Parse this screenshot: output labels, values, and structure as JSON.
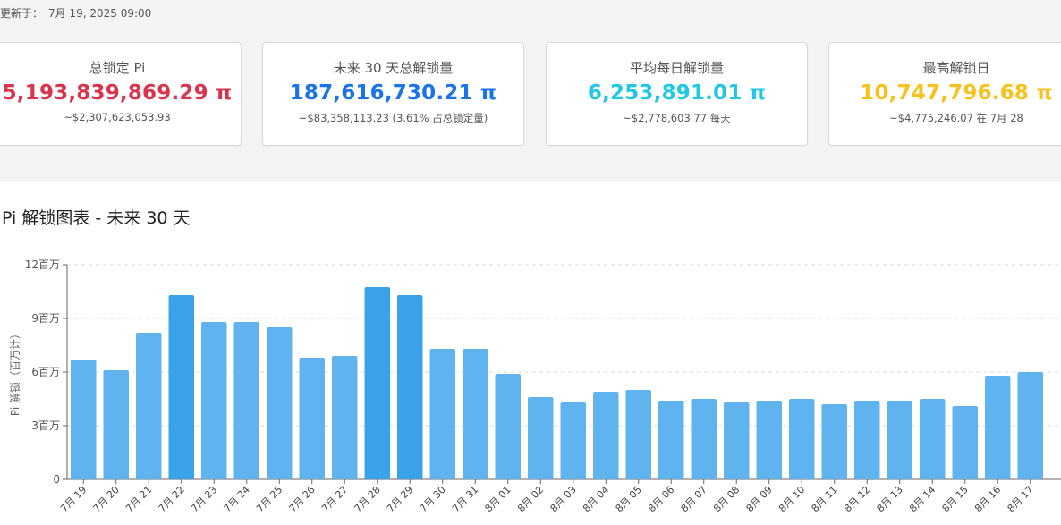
{
  "header": {
    "updated_label": "更新于：",
    "updated_value": "7月 19, 2025 09:00"
  },
  "cards": [
    {
      "title": "总锁定 Pi",
      "value": "5,193,839,869.29 π",
      "sub": "~$2,307,623,053.93",
      "color": "#d9344b"
    },
    {
      "title": "未来 30 天总解锁量",
      "value": "187,616,730.21 π",
      "sub": "~$83,358,113.23 (3.61% 占总锁定量)",
      "color": "#1a73e8"
    },
    {
      "title": "平均每日解锁量",
      "value": "6,253,891.01 π",
      "sub": "~$2,778,603.77 每天",
      "color": "#1ec8e6"
    },
    {
      "title": "最高解锁日",
      "value": "10,747,796.68 π",
      "sub": "~$4,775,246.07 在 7月 28",
      "color": "#f7c21d"
    }
  ],
  "chart_title": "Pi 解锁图表 - 未来 30 天",
  "colors": {
    "bar": "#5fb3ee",
    "bar_high": "#3aa2e9",
    "grid": "#d8d8d8",
    "axis": "#666666"
  },
  "chart_data": {
    "type": "bar",
    "categories": [
      "7月 19",
      "7月 20",
      "7月 21",
      "7月 22",
      "7月 23",
      "7月 24",
      "7月 25",
      "7月 26",
      "7月 27",
      "7月 28",
      "7月 29",
      "7月 30",
      "7月 31",
      "8月 01",
      "8月 02",
      "8月 03",
      "8月 04",
      "8月 05",
      "8月 06",
      "8月 07",
      "8月 08",
      "8月 09",
      "8月 10",
      "8月 11",
      "8月 12",
      "8月 13",
      "8月 14",
      "8月 15",
      "8月 16",
      "8月 17"
    ],
    "values": [
      6.7,
      6.1,
      8.2,
      10.3,
      8.8,
      8.8,
      8.5,
      6.8,
      6.9,
      10.75,
      10.3,
      7.3,
      7.3,
      5.9,
      4.6,
      4.3,
      4.9,
      5.0,
      4.4,
      4.5,
      4.3,
      4.4,
      4.5,
      4.2,
      4.4,
      4.4,
      4.5,
      4.1,
      5.8,
      6.0
    ],
    "ylabel": "Pi 解锁（百万计）",
    "ylim": [
      0,
      12
    ],
    "yticks": [
      0,
      3,
      6,
      9,
      12
    ],
    "ytick_labels": [
      "0",
      "3百万",
      "6百万",
      "9百万",
      "12百万"
    ],
    "grid": true
  }
}
